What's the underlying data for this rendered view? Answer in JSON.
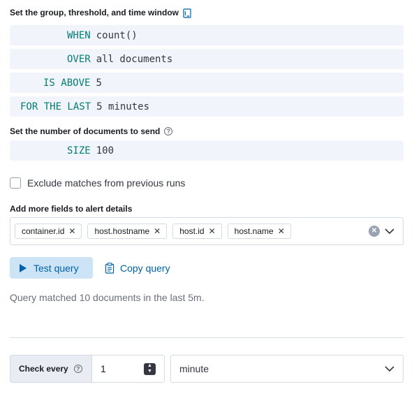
{
  "group_section": {
    "heading": "Set the group, threshold, and time window",
    "when": {
      "keyword": "WHEN",
      "value": "count()"
    },
    "over": {
      "keyword": "OVER",
      "value": "all documents"
    },
    "is_above": {
      "keyword": "IS ABOVE",
      "value": "5"
    },
    "for_the_last": {
      "keyword": "FOR THE LAST",
      "value": "5 minutes"
    }
  },
  "size_section": {
    "heading": "Set the number of documents to send",
    "keyword": "SIZE",
    "value": "100"
  },
  "exclude_checkbox": {
    "label": "Exclude matches from previous runs",
    "checked": false
  },
  "fields_section": {
    "heading": "Add more fields to alert details",
    "fields": [
      "container.id",
      "host.hostname",
      "host.id",
      "host.name"
    ]
  },
  "actions": {
    "test_query_label": "Test query",
    "copy_query_label": "Copy query"
  },
  "query_result": "Query matched 10 documents in the last 5m.",
  "schedule": {
    "check_every_label": "Check every",
    "interval_value": "1",
    "unit_value": "minute"
  },
  "colors": {
    "keyword": "#017d73",
    "primary": "#0061a6",
    "primary_bg": "#cce4f5"
  }
}
